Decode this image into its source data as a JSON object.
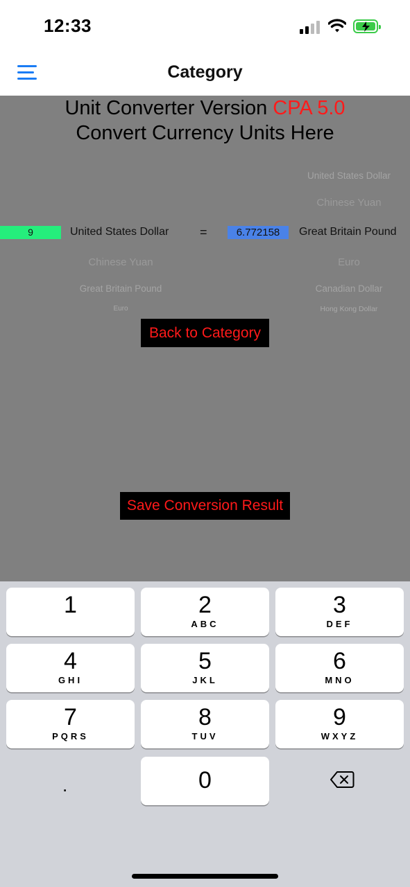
{
  "status_bar": {
    "time": "12:33",
    "battery_color": "#3ccb4a"
  },
  "nav": {
    "title": "Category",
    "menu_icon": "hamburger-menu-icon",
    "accent": "#1a7cf5"
  },
  "header": {
    "line1_prefix": "Unit Converter Version ",
    "line1_version": "CPA 5.0",
    "line2": "Convert Currency Units Here",
    "version_color": "#ff1a1a"
  },
  "converter": {
    "input_value": "9",
    "equals": "=",
    "result_value": "6.772158",
    "from_picker": {
      "above": [],
      "selected": "United States Dollar",
      "below": [
        "Chinese Yuan",
        "Great Britain Pound",
        "Euro"
      ]
    },
    "to_picker": {
      "above": [
        "United States Dollar",
        "Chinese Yuan"
      ],
      "selected": "Great Britain Pound",
      "below": [
        "Euro",
        "Canadian Dollar",
        "Hong Kong Dollar"
      ]
    },
    "input_color": "#25ee7c",
    "result_color": "#4a82e8"
  },
  "buttons": {
    "back": "Back to Category",
    "save": "Save Conversion Result"
  },
  "keypad": {
    "keys": [
      {
        "digit": "1",
        "letters": ""
      },
      {
        "digit": "2",
        "letters": "ABC"
      },
      {
        "digit": "3",
        "letters": "DEF"
      },
      {
        "digit": "4",
        "letters": "GHI"
      },
      {
        "digit": "5",
        "letters": "JKL"
      },
      {
        "digit": "6",
        "letters": "MNO"
      },
      {
        "digit": "7",
        "letters": "PQRS"
      },
      {
        "digit": "8",
        "letters": "TUV"
      },
      {
        "digit": "9",
        "letters": "WXYZ"
      },
      {
        "digit": "0",
        "letters": ""
      }
    ],
    "decimal": ".",
    "backspace_icon": "backspace-icon"
  }
}
